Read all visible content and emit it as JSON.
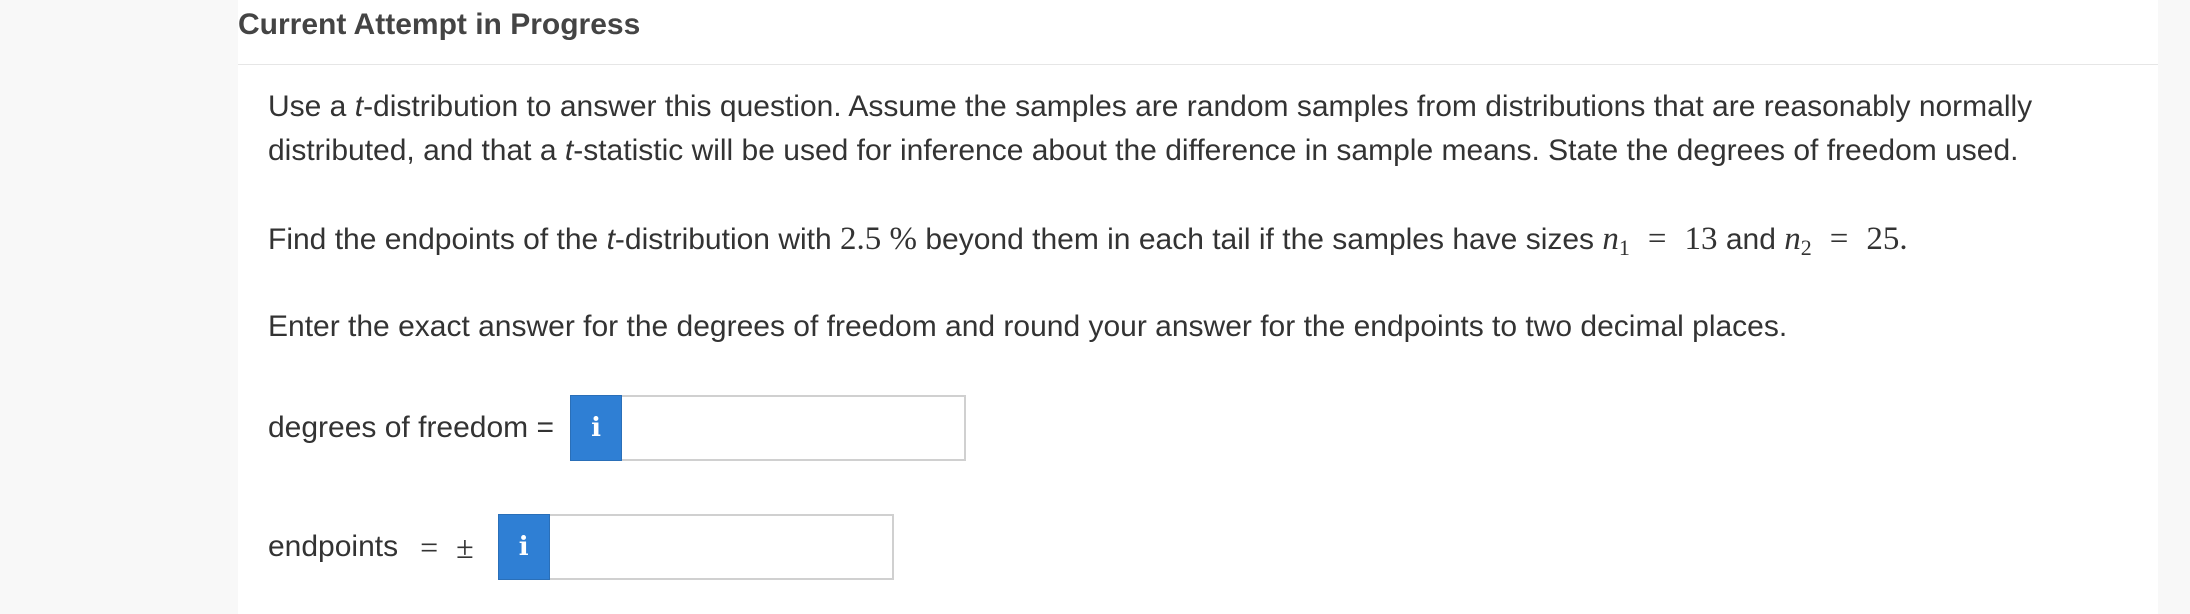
{
  "header": {
    "title": "Current Attempt in Progress"
  },
  "question": {
    "p1": {
      "a": "Use a ",
      "t": "t",
      "b": "-distribution to answer this question. Assume the samples are random samples from distributions that are reasonably normally",
      "c": "distributed, and that a ",
      "t2": "t",
      "d": "-statistic will be used for inference about the difference in sample means. State the degrees of freedom used."
    },
    "p2": {
      "a": "Find the endpoints of the ",
      "t": "t",
      "b": "-distribution with ",
      "pct": "2.5 %",
      "c": " beyond them in each tail if the samples have sizes ",
      "n": "n",
      "sub1": "1",
      "eq": "=",
      "v1": "13",
      "and": " and ",
      "n2": "n",
      "sub2": "2",
      "eq2": "=",
      "v2": "25."
    },
    "p3": "Enter the exact answer for the degrees of freedom and round your answer for the endpoints to two decimal places."
  },
  "answers": {
    "df_label": "degrees of freedom =",
    "df_info": "i",
    "df_value": "",
    "ep_label": "endpoints",
    "ep_eq": "=",
    "ep_pm": "±",
    "ep_info": "i",
    "ep_value": ""
  },
  "colors": {
    "info_button": "#2f7fd4",
    "heading": "#444444"
  }
}
